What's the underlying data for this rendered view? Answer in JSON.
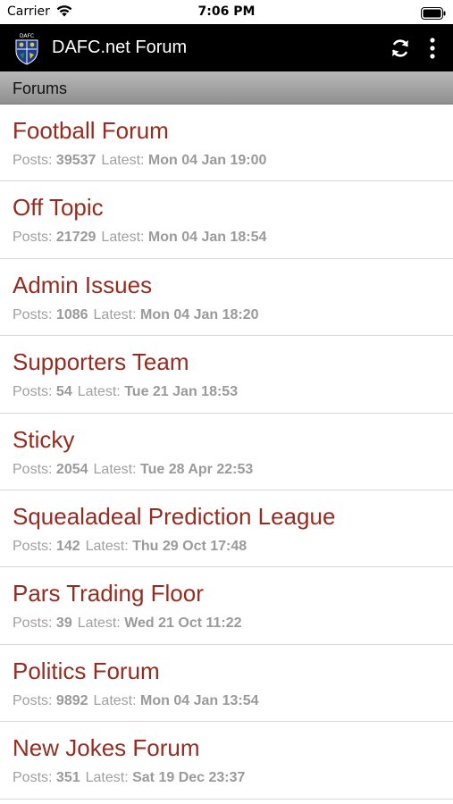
{
  "status_bar": {
    "carrier": "Carrier",
    "time": "7:06 PM"
  },
  "app_bar": {
    "title": "DAFC.net Forum",
    "logo_text": "DAFC",
    "background": "#000000"
  },
  "section": {
    "title": "Forums"
  },
  "labels": {
    "posts": "Posts:",
    "latest": "Latest:"
  },
  "colors": {
    "forum_name": "#962b1f",
    "meta": "#a0a0a0"
  },
  "forums": [
    {
      "name": "Football Forum",
      "posts": "39537",
      "latest": "Mon 04 Jan 19:00"
    },
    {
      "name": "Off Topic",
      "posts": "21729",
      "latest": "Mon 04 Jan 18:54"
    },
    {
      "name": "Admin Issues",
      "posts": "1086",
      "latest": "Mon 04 Jan 18:20"
    },
    {
      "name": "Supporters Team",
      "posts": "54",
      "latest": "Tue 21 Jan 18:53"
    },
    {
      "name": "Sticky",
      "posts": "2054",
      "latest": "Tue 28 Apr 22:53"
    },
    {
      "name": "Squealadeal Prediction League",
      "posts": "142",
      "latest": "Thu 29 Oct 17:48"
    },
    {
      "name": "Pars Trading Floor",
      "posts": "39",
      "latest": "Wed 21 Oct 11:22"
    },
    {
      "name": "Politics Forum",
      "posts": "9892",
      "latest": "Mon 04 Jan 13:54"
    },
    {
      "name": "New Jokes Forum",
      "posts": "351",
      "latest": "Sat 19 Dec 23:37"
    }
  ]
}
